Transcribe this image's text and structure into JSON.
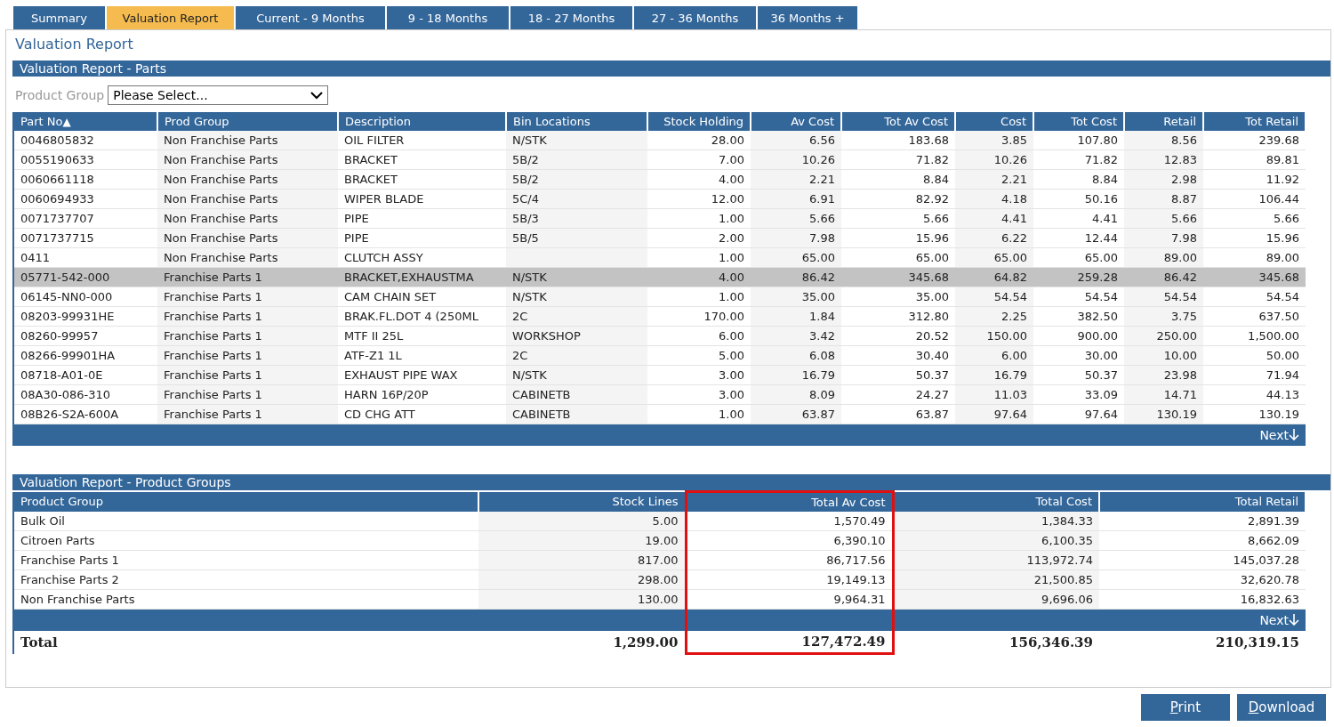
{
  "tabs": [
    {
      "label": "Summary",
      "selected": false
    },
    {
      "label": "Valuation Report",
      "selected": true
    },
    {
      "label": "Current - 9 Months",
      "selected": false
    },
    {
      "label": "9 - 18 Months",
      "selected": false
    },
    {
      "label": "18 - 27 Months",
      "selected": false
    },
    {
      "label": "27 - 36 Months",
      "selected": false
    },
    {
      "label": "36 Months +",
      "selected": false
    }
  ],
  "page_title": "Valuation Report",
  "parts": {
    "title": "Valuation Report - Parts",
    "filter": {
      "label": "Product Group",
      "value": "Please Select..."
    },
    "columns": [
      {
        "label": "Part No",
        "kind": "text",
        "sort": "▲"
      },
      {
        "label": "Prod Group",
        "kind": "text"
      },
      {
        "label": "Description",
        "kind": "text"
      },
      {
        "label": "Bin Locations",
        "kind": "text"
      },
      {
        "label": "Stock Holding",
        "kind": "number"
      },
      {
        "label": "Av Cost",
        "kind": "number"
      },
      {
        "label": "Tot Av Cost",
        "kind": "number"
      },
      {
        "label": "Cost",
        "kind": "number"
      },
      {
        "label": "Tot Cost",
        "kind": "number"
      },
      {
        "label": "Retail",
        "kind": "number"
      },
      {
        "label": "Tot Retail",
        "kind": "number"
      }
    ],
    "rows": [
      {
        "selected": false,
        "cells": [
          "0046805832",
          "Non Franchise Parts",
          "OIL FILTER",
          "N/STK",
          "28.00",
          "6.56",
          "183.68",
          "3.85",
          "107.80",
          "8.56",
          "239.68"
        ]
      },
      {
        "selected": false,
        "cells": [
          "0055190633",
          "Non Franchise Parts",
          "BRACKET",
          "5B/2",
          "7.00",
          "10.26",
          "71.82",
          "10.26",
          "71.82",
          "12.83",
          "89.81"
        ]
      },
      {
        "selected": false,
        "cells": [
          "0060661118",
          "Non Franchise Parts",
          "BRACKET",
          "5B/2",
          "4.00",
          "2.21",
          "8.84",
          "2.21",
          "8.84",
          "2.98",
          "11.92"
        ]
      },
      {
        "selected": false,
        "cells": [
          "0060694933",
          "Non Franchise Parts",
          "WIPER BLADE",
          "5C/4",
          "12.00",
          "6.91",
          "82.92",
          "4.18",
          "50.16",
          "8.87",
          "106.44"
        ]
      },
      {
        "selected": false,
        "cells": [
          "0071737707",
          "Non Franchise Parts",
          "PIPE",
          "5B/3",
          "1.00",
          "5.66",
          "5.66",
          "4.41",
          "4.41",
          "5.66",
          "5.66"
        ]
      },
      {
        "selected": false,
        "cells": [
          "0071737715",
          "Non Franchise Parts",
          "PIPE",
          "5B/5",
          "2.00",
          "7.98",
          "15.96",
          "6.22",
          "12.44",
          "7.98",
          "15.96"
        ]
      },
      {
        "selected": false,
        "cells": [
          "0411",
          "Non Franchise Parts",
          "CLUTCH ASSY",
          "",
          "1.00",
          "65.00",
          "65.00",
          "65.00",
          "65.00",
          "89.00",
          "89.00"
        ]
      },
      {
        "selected": true,
        "cells": [
          "05771-542-000",
          "Franchise Parts 1",
          "BRACKET,EXHAUSTMA",
          "N/STK",
          "4.00",
          "86.42",
          "345.68",
          "64.82",
          "259.28",
          "86.42",
          "345.68"
        ]
      },
      {
        "selected": false,
        "cells": [
          "06145-NN0-000",
          "Franchise Parts 1",
          "CAM CHAIN SET",
          "N/STK",
          "1.00",
          "35.00",
          "35.00",
          "54.54",
          "54.54",
          "54.54",
          "54.54"
        ]
      },
      {
        "selected": false,
        "cells": [
          "08203-99931HE",
          "Franchise Parts 1",
          "BRAK.FL.DOT 4 (250ML",
          "2C",
          "170.00",
          "1.84",
          "312.80",
          "2.25",
          "382.50",
          "3.75",
          "637.50"
        ]
      },
      {
        "selected": false,
        "cells": [
          "08260-99957",
          "Franchise Parts 1",
          "MTF II 25L",
          "WORKSHOP",
          "6.00",
          "3.42",
          "20.52",
          "150.00",
          "900.00",
          "250.00",
          "1,500.00"
        ]
      },
      {
        "selected": false,
        "cells": [
          "08266-99901HA",
          "Franchise Parts 1",
          "ATF-Z1 1L",
          "2C",
          "5.00",
          "6.08",
          "30.40",
          "6.00",
          "30.00",
          "10.00",
          "50.00"
        ]
      },
      {
        "selected": false,
        "cells": [
          "08718-A01-0E",
          "Franchise Parts 1",
          "EXHAUST PIPE WAX",
          "N/STK",
          "3.00",
          "16.79",
          "50.37",
          "16.79",
          "50.37",
          "23.98",
          "71.94"
        ]
      },
      {
        "selected": false,
        "cells": [
          "08A30-086-310",
          "Franchise Parts 1",
          "HARN 16P/20P",
          "CABINETB",
          "3.00",
          "8.09",
          "24.27",
          "11.03",
          "33.09",
          "14.71",
          "44.13"
        ]
      },
      {
        "selected": false,
        "cells": [
          "08B26-S2A-600A",
          "Franchise Parts 1",
          "CD CHG ATT",
          "CABINETB",
          "1.00",
          "63.87",
          "63.87",
          "97.64",
          "97.64",
          "130.19",
          "130.19"
        ]
      }
    ],
    "next": "Next"
  },
  "groups": {
    "title": "Valuation Report - Product Groups",
    "columns": [
      {
        "label": "Product Group",
        "kind": "text",
        "highlighted": false
      },
      {
        "label": "Stock Lines",
        "kind": "number",
        "highlighted": false
      },
      {
        "label": "Total Av Cost",
        "kind": "number",
        "highlighted": true
      },
      {
        "label": "Total Cost",
        "kind": "number",
        "highlighted": false
      },
      {
        "label": "Total Retail",
        "kind": "number",
        "highlighted": false
      }
    ],
    "rows": [
      [
        "Bulk Oil",
        "5.00",
        "1,570.49",
        "1,384.33",
        "2,891.39"
      ],
      [
        "Citroen Parts",
        "19.00",
        "6,390.10",
        "6,100.35",
        "8,662.09"
      ],
      [
        "Franchise Parts 1",
        "817.00",
        "86,717.56",
        "113,972.74",
        "145,037.28"
      ],
      [
        "Franchise Parts 2",
        "298.00",
        "19,149.13",
        "21,500.85",
        "32,620.78"
      ],
      [
        "Non Franchise Parts",
        "130.00",
        "9,964.31",
        "9,696.06",
        "16,832.63"
      ]
    ],
    "next": "Next",
    "total": [
      "Total",
      "1,299.00",
      "127,472.49",
      "156,346.39",
      "210,319.15"
    ]
  },
  "buttons": [
    "Print",
    "Download"
  ]
}
